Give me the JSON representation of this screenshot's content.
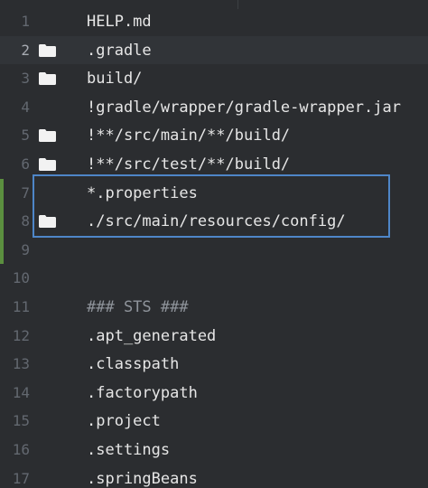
{
  "editor": {
    "lines": [
      {
        "number": "1",
        "text": "HELP.md",
        "folder": false,
        "current": false,
        "modified": false,
        "comment": false
      },
      {
        "number": "2",
        "text": ".gradle",
        "folder": true,
        "current": true,
        "modified": false,
        "comment": false
      },
      {
        "number": "3",
        "text": "build/",
        "folder": true,
        "current": false,
        "modified": false,
        "comment": false
      },
      {
        "number": "4",
        "text": "!gradle/wrapper/gradle-wrapper.jar",
        "folder": false,
        "current": false,
        "modified": false,
        "comment": false
      },
      {
        "number": "5",
        "text": "!**/src/main/**/build/",
        "folder": true,
        "current": false,
        "modified": false,
        "comment": false
      },
      {
        "number": "6",
        "text": "!**/src/test/**/build/",
        "folder": true,
        "current": false,
        "modified": false,
        "comment": false
      },
      {
        "number": "7",
        "text": "*.properties",
        "folder": false,
        "current": false,
        "modified": true,
        "comment": false
      },
      {
        "number": "8",
        "text": "./src/main/resources/config/",
        "folder": true,
        "current": false,
        "modified": true,
        "comment": false
      },
      {
        "number": "9",
        "text": "",
        "folder": false,
        "current": false,
        "modified": true,
        "comment": false
      },
      {
        "number": "10",
        "text": "",
        "folder": false,
        "current": false,
        "modified": false,
        "comment": false
      },
      {
        "number": "11",
        "text": "### STS ###",
        "folder": false,
        "current": false,
        "modified": false,
        "comment": true
      },
      {
        "number": "12",
        "text": ".apt_generated",
        "folder": false,
        "current": false,
        "modified": false,
        "comment": false
      },
      {
        "number": "13",
        "text": ".classpath",
        "folder": false,
        "current": false,
        "modified": false,
        "comment": false
      },
      {
        "number": "14",
        "text": ".factorypath",
        "folder": false,
        "current": false,
        "modified": false,
        "comment": false
      },
      {
        "number": "15",
        "text": ".project",
        "folder": false,
        "current": false,
        "modified": false,
        "comment": false
      },
      {
        "number": "16",
        "text": ".settings",
        "folder": false,
        "current": false,
        "modified": false,
        "comment": false
      },
      {
        "number": "17",
        "text": ".springBeans",
        "folder": false,
        "current": false,
        "modified": false,
        "comment": false
      }
    ]
  },
  "colors": {
    "background": "#2b2d30",
    "current_line": "#313438",
    "highlight_box": "#4e86c8",
    "modified_marker": "#5b8f3f",
    "text": "#e6e6e6",
    "line_number": "#636870"
  },
  "icons": {
    "folder": "folder-icon"
  }
}
